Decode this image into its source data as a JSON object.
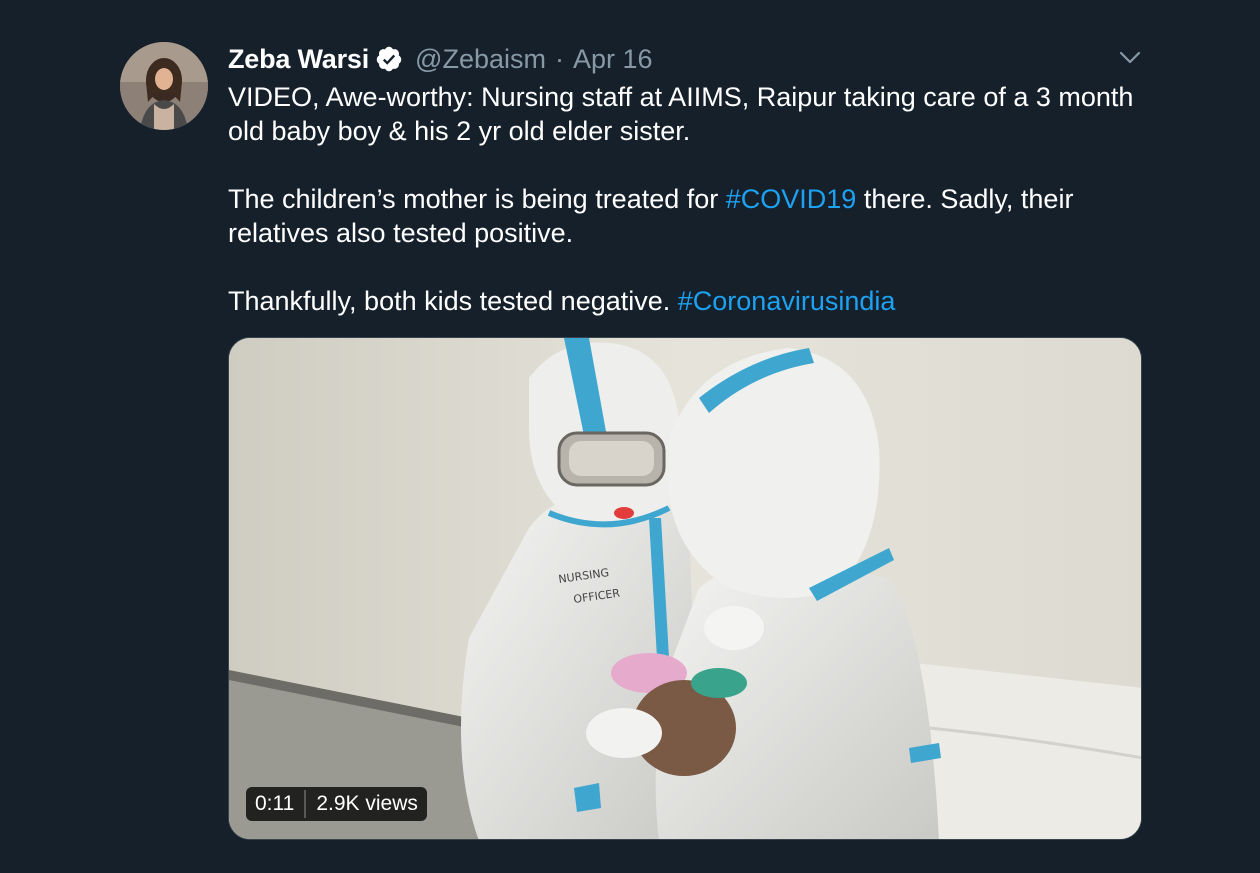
{
  "tweet": {
    "author": {
      "display_name": "Zeba Warsi",
      "handle": "@Zebaism",
      "verified_icon": "verified-badge-icon",
      "avatar_icon": "profile-avatar"
    },
    "separator": "·",
    "date": "Apr 16",
    "menu_icon": "chevron-down-icon",
    "text": {
      "paragraph1": "VIDEO, Awe-worthy: Nursing staff at AIIMS, Raipur taking care of a 3 month old baby boy & his 2 yr old elder sister.",
      "paragraph2_before": "The children’s mother is being treated for ",
      "paragraph2_hashtag": "#COVID19",
      "paragraph2_after": " there. Sadly, their relatives also tested positive.",
      "paragraph3_before": "Thankfully, both kids tested negative. ",
      "paragraph3_hashtag": "#Coronavirusindia"
    },
    "media": {
      "duration": "0:11",
      "views": "2.9K views"
    }
  },
  "colors": {
    "background": "#15202b",
    "text_primary": "#ffffff",
    "text_secondary": "#8899a6",
    "link": "#1da1f2",
    "border": "#38444d"
  }
}
